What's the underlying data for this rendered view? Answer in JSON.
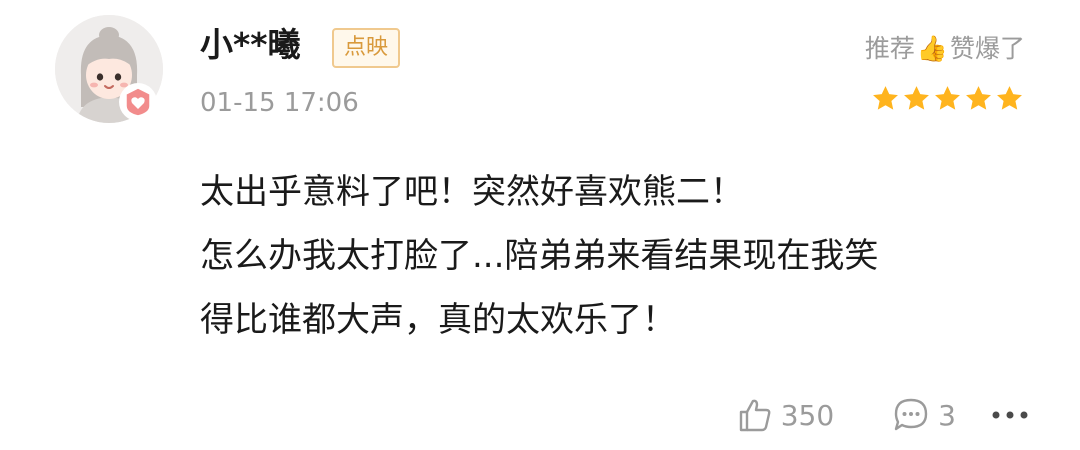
{
  "comment": {
    "user": {
      "name": "小**曦",
      "tag": "点映",
      "avatar_icon": "girl-avatar-icon",
      "badge_icon": "heart-badge-icon"
    },
    "timestamp": "01-15 17:06",
    "rating": {
      "text_before": "推荐",
      "emoji": "👍",
      "text_after": "赞爆了",
      "stars": 5,
      "max_stars": 5,
      "star_color": "#ffb41e"
    },
    "content_lines": [
      "太出乎意料了吧！突然好喜欢熊二！",
      "怎么办我太打脸了...陪弟弟来看结果现在我笑",
      "得比谁都大声，真的太欢乐了！"
    ],
    "likes": "350",
    "replies": "3",
    "more_icon": "more-dots-icon"
  },
  "colors": {
    "text_primary": "#1a1a1a",
    "text_secondary": "#9b9b9b",
    "tag_text": "#d99a3c",
    "tag_border": "#f0c98e",
    "badge_pink": "#f28c8c"
  }
}
